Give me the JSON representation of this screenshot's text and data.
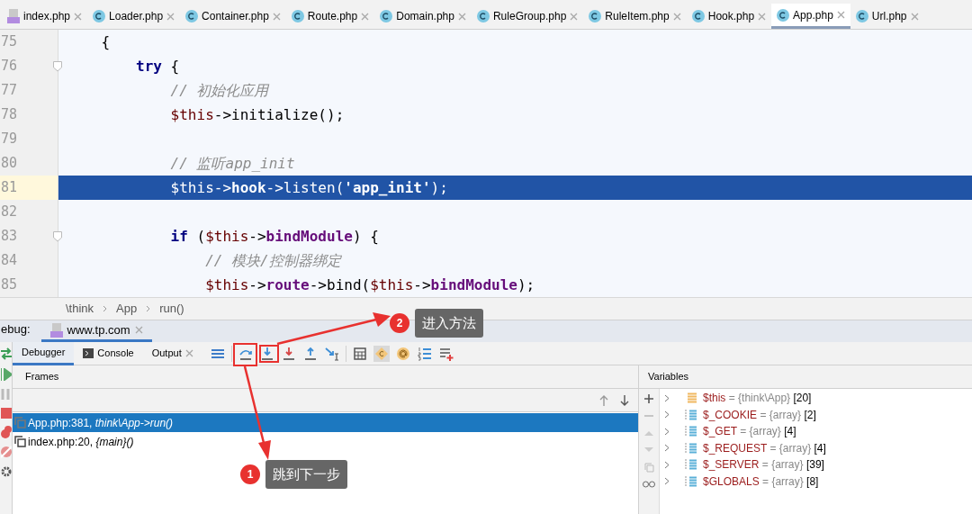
{
  "editor_tabs": [
    {
      "label": "index.php",
      "kind": "php",
      "selected": false
    },
    {
      "label": "Loader.php",
      "kind": "class",
      "selected": false
    },
    {
      "label": "Container.php",
      "kind": "class",
      "selected": false
    },
    {
      "label": "Route.php",
      "kind": "class",
      "selected": false
    },
    {
      "label": "Domain.php",
      "kind": "class",
      "selected": false
    },
    {
      "label": "RuleGroup.php",
      "kind": "class",
      "selected": false
    },
    {
      "label": "RuleItem.php",
      "kind": "class",
      "selected": false
    },
    {
      "label": "Hook.php",
      "kind": "class",
      "selected": false
    },
    {
      "label": "App.php",
      "kind": "class",
      "selected": true
    },
    {
      "label": "Url.php",
      "kind": "class",
      "selected": false
    }
  ],
  "code_lines": [
    {
      "number": "75",
      "selected": false,
      "fold": false,
      "tokens": [
        {
          "kind": "plain",
          "text": "    {"
        }
      ]
    },
    {
      "number": "76",
      "selected": false,
      "fold": true,
      "tokens": [
        {
          "kind": "keyword",
          "text": "        try"
        },
        {
          "kind": "plain",
          "text": " {"
        }
      ]
    },
    {
      "number": "77",
      "selected": false,
      "fold": false,
      "tokens": [
        {
          "kind": "comment",
          "text": "            // 初始化应用"
        }
      ]
    },
    {
      "number": "78",
      "selected": false,
      "fold": false,
      "tokens": [
        {
          "kind": "var",
          "text": "            $this"
        },
        {
          "kind": "plain",
          "text": "->initialize();"
        }
      ]
    },
    {
      "number": "79",
      "selected": false,
      "fold": false
    },
    {
      "number": "80",
      "selected": false,
      "fold": false,
      "tokens": [
        {
          "kind": "comment",
          "text": "            // 监听app_init"
        }
      ]
    },
    {
      "number": "81",
      "selected": true,
      "fold": false,
      "tokens": [
        {
          "kind": "var",
          "text": "            $this"
        },
        {
          "kind": "plain",
          "text": "->"
        },
        {
          "kind": "prop",
          "text": "hook"
        },
        {
          "kind": "plain",
          "text": "->listen("
        },
        {
          "kind": "string",
          "text": "'app_init'"
        },
        {
          "kind": "plain",
          "text": ");"
        }
      ]
    },
    {
      "number": "82",
      "selected": false,
      "fold": false
    },
    {
      "number": "83",
      "selected": false,
      "fold": true,
      "tokens": [
        {
          "kind": "keyword",
          "text": "            if"
        },
        {
          "kind": "plain",
          "text": " ("
        },
        {
          "kind": "var",
          "text": "$this"
        },
        {
          "kind": "plain",
          "text": "->"
        },
        {
          "kind": "prop",
          "text": "bindModule"
        },
        {
          "kind": "plain",
          "text": ") {"
        }
      ]
    },
    {
      "number": "84",
      "selected": false,
      "fold": false,
      "tokens": [
        {
          "kind": "comment",
          "text": "                // 模块/控制器绑定"
        }
      ]
    },
    {
      "number": "85",
      "selected": false,
      "fold": false,
      "tokens": [
        {
          "kind": "var",
          "text": "                $this"
        },
        {
          "kind": "plain",
          "text": "->"
        },
        {
          "kind": "prop",
          "text": "route"
        },
        {
          "kind": "plain",
          "text": "->bind("
        },
        {
          "kind": "var",
          "text": "$this"
        },
        {
          "kind": "plain",
          "text": "->"
        },
        {
          "kind": "prop",
          "text": "bindModule"
        },
        {
          "kind": "plain",
          "text": ");"
        }
      ]
    }
  ],
  "breadcrumb": [
    "\\think",
    "App",
    "run()"
  ],
  "debug": {
    "label": "ebug:",
    "session": {
      "label": "www.tp.com",
      "selected": true
    }
  },
  "tool_tabs": [
    {
      "label": "Debugger",
      "kind": "plain",
      "selected": true
    },
    {
      "label": "Console",
      "kind": "console",
      "selected": false
    },
    {
      "label": "Output",
      "kind": "closable",
      "selected": false
    }
  ],
  "frames": {
    "title": "Frames",
    "rows": [
      {
        "text": "App.php:381, *think\\App->run()*",
        "selected": true
      },
      {
        "text": "index.php:20, *{main}()*",
        "selected": false
      }
    ]
  },
  "variables": {
    "title": "Variables",
    "items": [
      {
        "kind": "object",
        "name": "$this",
        "value": "= {think\\App}",
        "count": "[20]"
      },
      {
        "kind": "array",
        "name": "$_COOKIE",
        "value": "= {array}",
        "count": "[2]"
      },
      {
        "kind": "array",
        "name": "$_GET",
        "value": "= {array}",
        "count": "[4]"
      },
      {
        "kind": "array",
        "name": "$_REQUEST",
        "value": "= {array}",
        "count": "[4]"
      },
      {
        "kind": "array",
        "name": "$_SERVER",
        "value": "= {array}",
        "count": "[39]"
      },
      {
        "kind": "array",
        "name": "$GLOBALS",
        "value": "= {array}",
        "count": "[8]"
      }
    ]
  },
  "annotations": [
    {
      "number": "2",
      "label": "进入方法"
    },
    {
      "number": "1",
      "label": "跳到下一步"
    }
  ]
}
